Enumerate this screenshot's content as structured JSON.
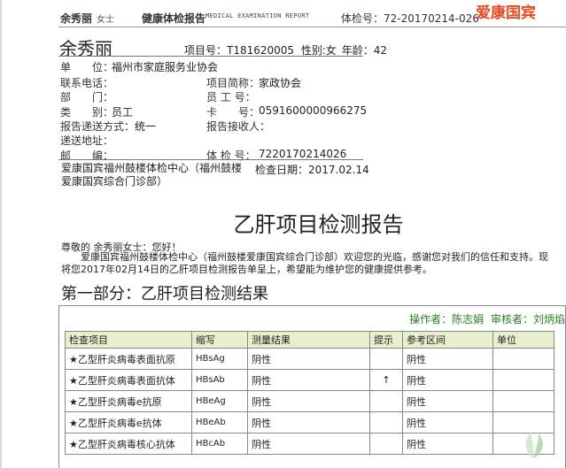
{
  "header": {
    "name": "余秀丽",
    "gender_title": "女士",
    "title": "健康体检报告",
    "subtitle": "MEDICAL EXAMINATION REPORT",
    "exam_no": "体检号：72-20170214-026",
    "brand": "爱康国宾"
  },
  "patient": {
    "name": "余秀丽",
    "project_no": "项目号：T181620005",
    "gender": "性别:女",
    "age": "年龄：42"
  },
  "info_rows": [
    {
      "label": "单　　位：",
      "value": "福州市家庭服务业协会"
    },
    {
      "label": "联系电话：",
      "value": "",
      "label2": "项目简称：",
      "value2": "家政协会"
    },
    {
      "label": "部　　门：",
      "value": "",
      "label2": "员 工 号：",
      "value2": ""
    },
    {
      "label": "类　　别：",
      "value": "员工",
      "label2": "卡　　号：",
      "value2": "0591600000966275"
    },
    {
      "label": "报告递送方式：",
      "value": "统一",
      "label2": "报告接收人：",
      "value2": ""
    },
    {
      "label": "递送地址：",
      "value": ""
    },
    {
      "label": "邮　　编：",
      "value": "",
      "label2": "体 检 号：",
      "value2": "7220170214026"
    }
  ],
  "center": {
    "name": "爱康国宾福州鼓楼体检中心（福州鼓楼爱康国宾综合门诊部）",
    "exam_date": "检查日期：2017.02.14"
  },
  "report_title": "乙肝项目检测报告",
  "greeting": "尊敬的 余秀丽女士：您好！",
  "intro": "爱康国宾福州鼓楼体检中心（福州鼓楼爱康国宾综合门诊部）欢迎您的光临，感谢您对我们的信任和支持。现将您2017年02月14日的乙肝项目检测报告单呈上，希望能为维护您的健康提供参考。",
  "section_title": "第一部分：乙肝项目检测结果",
  "table": {
    "operator": "操作者：陈志娟",
    "reviewer": "审核者：刘炳焰",
    "headers": [
      "检查项目",
      "缩写",
      "测量结果",
      "提示",
      "参考区间",
      "单位"
    ],
    "rows": [
      [
        "★乙型肝炎病毒表面抗原",
        "HBsAg",
        "阴性",
        "",
        "阴性",
        ""
      ],
      [
        "★乙型肝炎病毒表面抗体",
        "HBsAb",
        "阴性",
        "↑",
        "阴性",
        ""
      ],
      [
        "★乙型肝炎病毒e抗原",
        "HBeAg",
        "阴性",
        "",
        "阴性",
        ""
      ],
      [
        "★乙型肝炎病毒e抗体",
        "HBeAb",
        "阴性",
        "",
        "阴性",
        ""
      ],
      [
        "★乙型肝炎病毒核心抗体",
        "HBcAb",
        "阴性",
        "",
        "阴性",
        ""
      ]
    ]
  },
  "colors": {
    "brand": "#e84a22",
    "header_bg": "#e8efcd",
    "ops_text": "#2e7d24"
  },
  "icons": {
    "watermark": "leaf-logo-icon"
  }
}
